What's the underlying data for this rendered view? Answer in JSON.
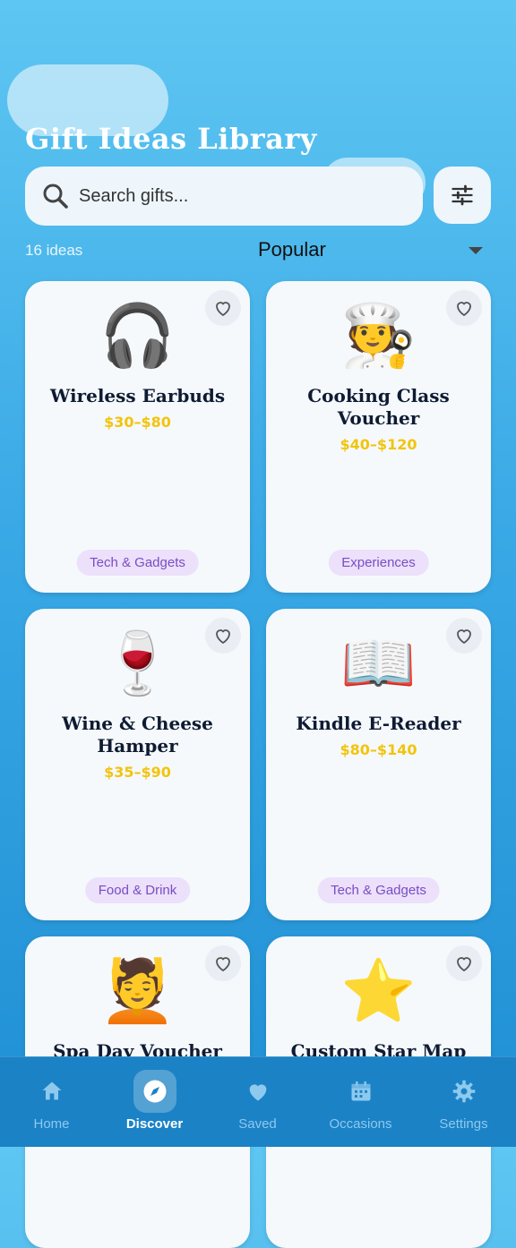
{
  "header": {
    "title": "Gift Ideas Library"
  },
  "search": {
    "placeholder": "Search gifts..."
  },
  "list_meta": {
    "count_text": "16 ideas",
    "sort_label": "Popular"
  },
  "gifts": [
    {
      "emoji": "🎧",
      "name": "Wireless Earbuds",
      "price": "$30–$80",
      "tag": "Tech & Gadgets"
    },
    {
      "emoji": "🧑‍🍳",
      "name": "Cooking Class Voucher",
      "price": "$40–$120",
      "tag": "Experiences"
    },
    {
      "emoji": "🍷",
      "name": "Wine & Cheese Hamper",
      "price": "$35–$90",
      "tag": "Food & Drink"
    },
    {
      "emoji": "📖",
      "name": "Kindle E-Reader",
      "price": "$80–$140",
      "tag": "Tech & Gadgets"
    },
    {
      "emoji": "💆",
      "name": "Spa Day Voucher"
    },
    {
      "emoji": "⭐",
      "name": "Custom Star Map"
    }
  ],
  "nav": {
    "items": [
      {
        "label": "Home",
        "icon": "home-icon"
      },
      {
        "label": "Discover",
        "icon": "compass-icon",
        "active": true
      },
      {
        "label": "Saved",
        "icon": "heart-icon"
      },
      {
        "label": "Occasions",
        "icon": "calendar-icon"
      },
      {
        "label": "Settings",
        "icon": "gear-icon"
      }
    ]
  },
  "colors": {
    "accent_price": "#f2c40d",
    "tag_bg": "#ece0fb",
    "tag_text": "#7a4cc4",
    "nav_bg": "#1b82c6"
  }
}
